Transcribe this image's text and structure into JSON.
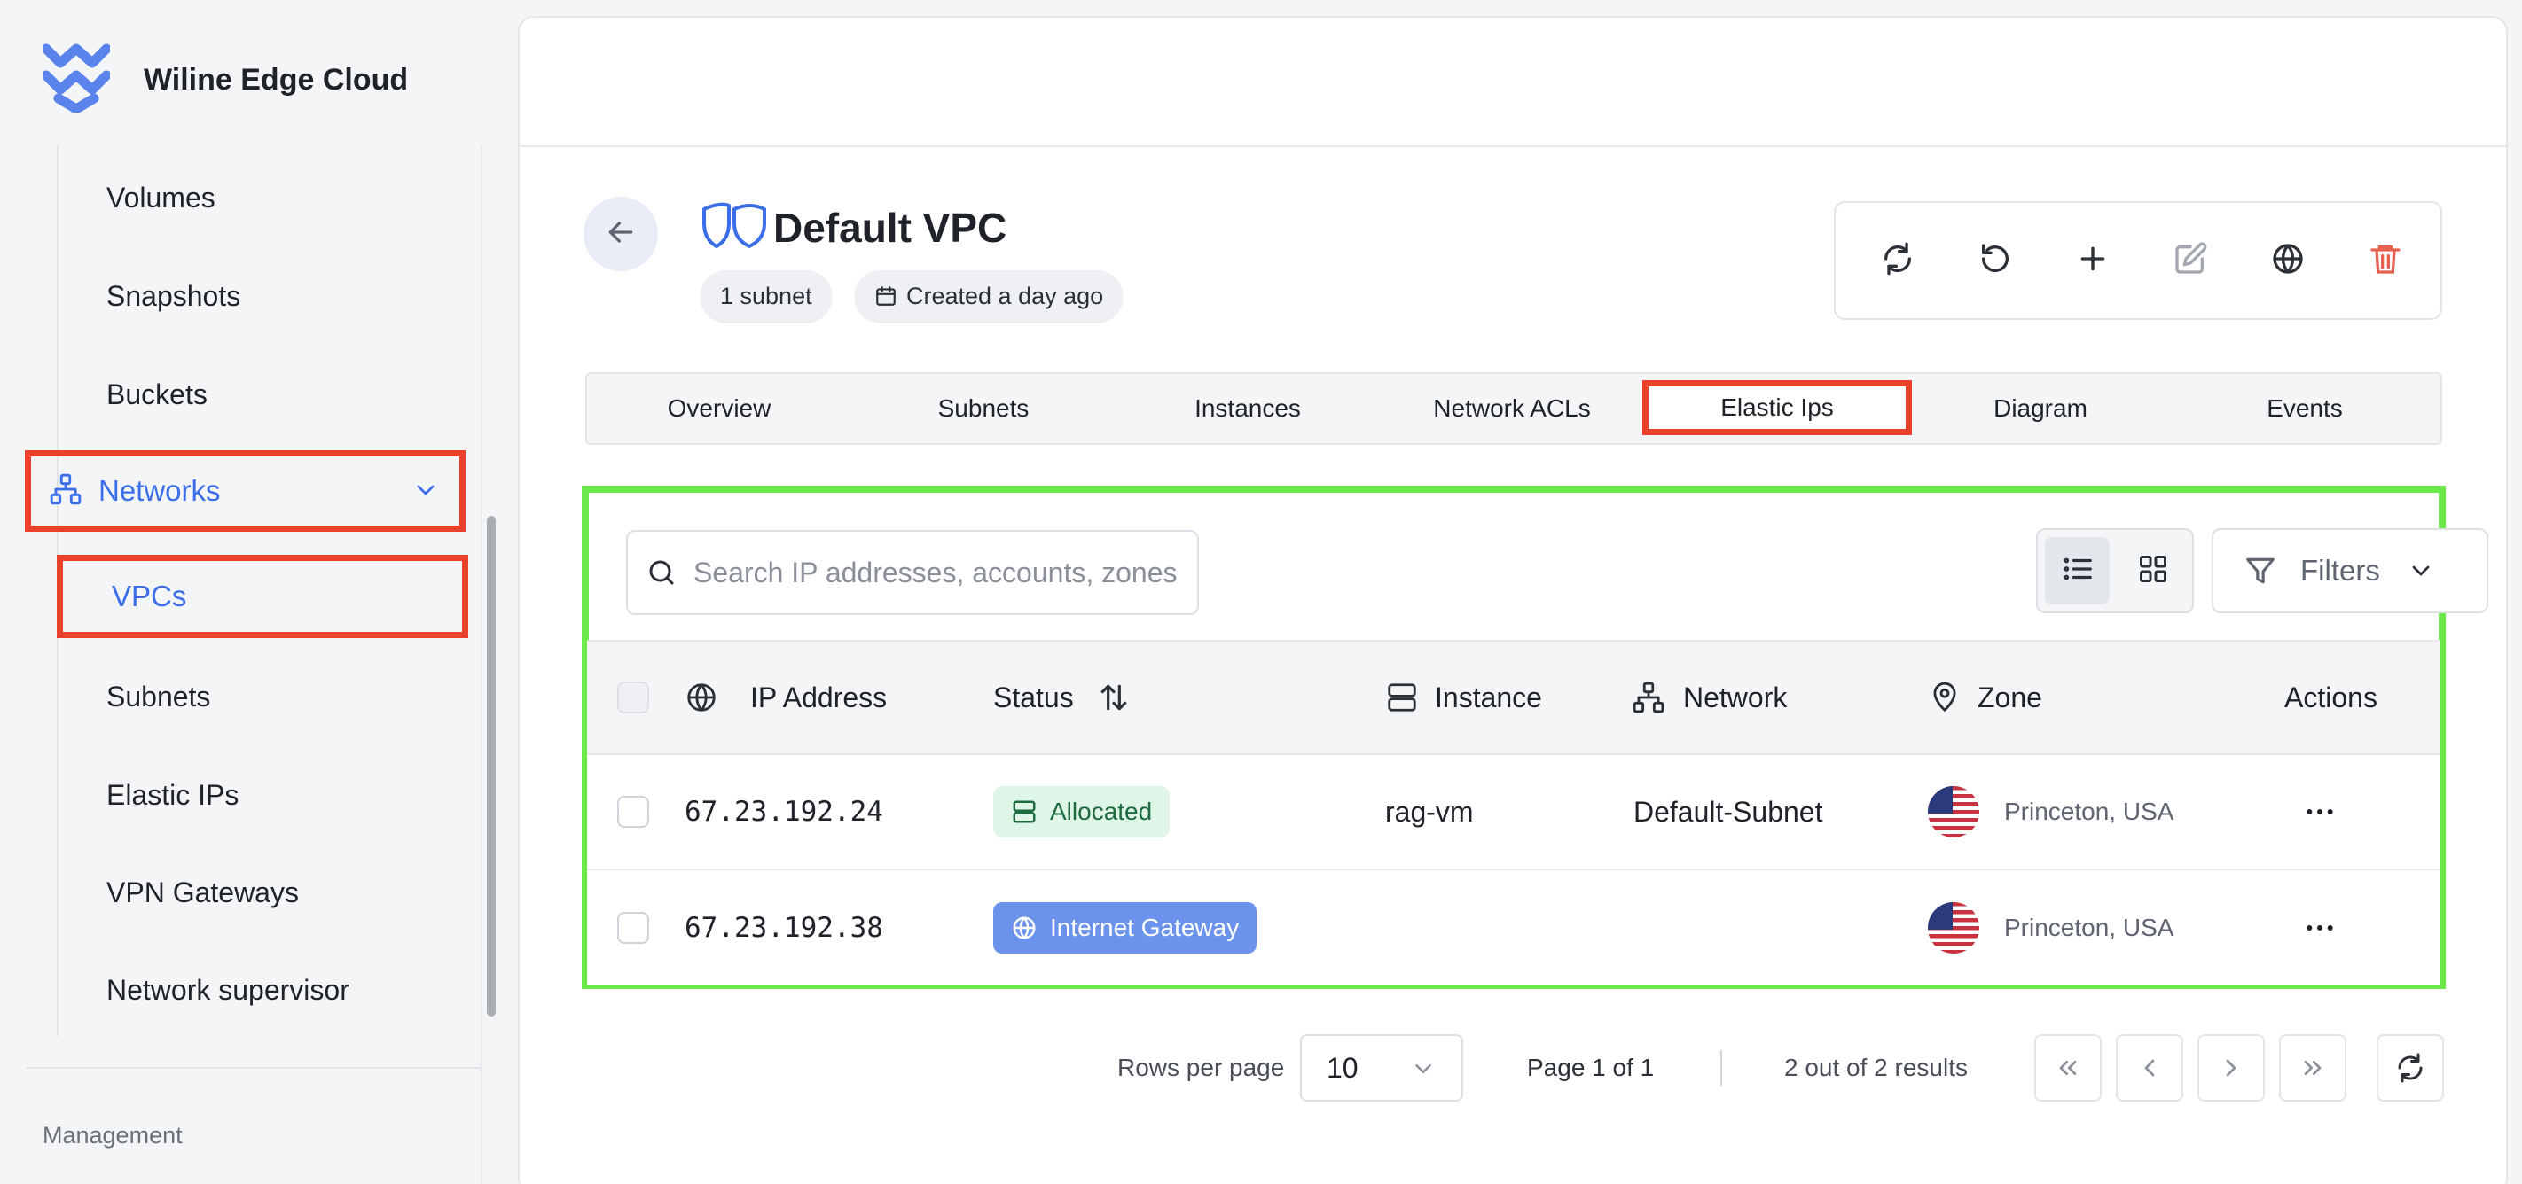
{
  "app": {
    "name": "Wiline Edge Cloud"
  },
  "sidebar": {
    "items_top": [
      {
        "label": "Volumes"
      },
      {
        "label": "Snapshots"
      },
      {
        "label": "Buckets"
      }
    ],
    "networks_group": {
      "label": "Networks",
      "expanded": true
    },
    "active_item": {
      "label": "VPCs"
    },
    "items_bottom": [
      {
        "label": "Subnets"
      },
      {
        "label": "Elastic IPs"
      },
      {
        "label": "VPN Gateways"
      },
      {
        "label": "Network supervisor"
      }
    ],
    "section_label": "Management"
  },
  "header": {
    "title": "Default VPC",
    "chips": {
      "subnets": "1 subnet",
      "created": "Created a day ago"
    },
    "toolbar_icons": [
      "refresh-icon",
      "undo-icon",
      "plus-icon",
      "edit-icon",
      "globe-icon",
      "trash-icon"
    ]
  },
  "tabs": [
    {
      "label": "Overview"
    },
    {
      "label": "Subnets"
    },
    {
      "label": "Instances"
    },
    {
      "label": "Network ACLs"
    },
    {
      "label": "Elastic Ips",
      "active": true
    },
    {
      "label": "Diagram"
    },
    {
      "label": "Events"
    }
  ],
  "search": {
    "placeholder": "Search IP addresses, accounts, zones",
    "value": ""
  },
  "filters": {
    "label": "Filters"
  },
  "table": {
    "columns": {
      "ip": "IP Address",
      "status": "Status",
      "instance": "Instance",
      "network": "Network",
      "zone": "Zone",
      "actions": "Actions"
    },
    "rows": [
      {
        "ip": "67.23.192.24",
        "status": "Allocated",
        "instance": "rag-vm",
        "network": "Default-Subnet",
        "zone": "Princeton, USA"
      },
      {
        "ip": "67.23.192.38",
        "status": "Internet Gateway",
        "instance": "",
        "network": "",
        "zone": "Princeton, USA"
      }
    ]
  },
  "pagination": {
    "rows_per_page_label": "Rows per page",
    "rows_per_page": "10",
    "page_info": "Page 1 of 1",
    "results": "2 out of 2 results"
  },
  "colors": {
    "accent": "#3b6ee8",
    "highlight_red": "#e8412c",
    "highlight_green": "#6be84a",
    "status_allocated_bg": "#dff5e7",
    "status_gateway_bg": "#6b93eb",
    "danger": "#e8604f"
  }
}
